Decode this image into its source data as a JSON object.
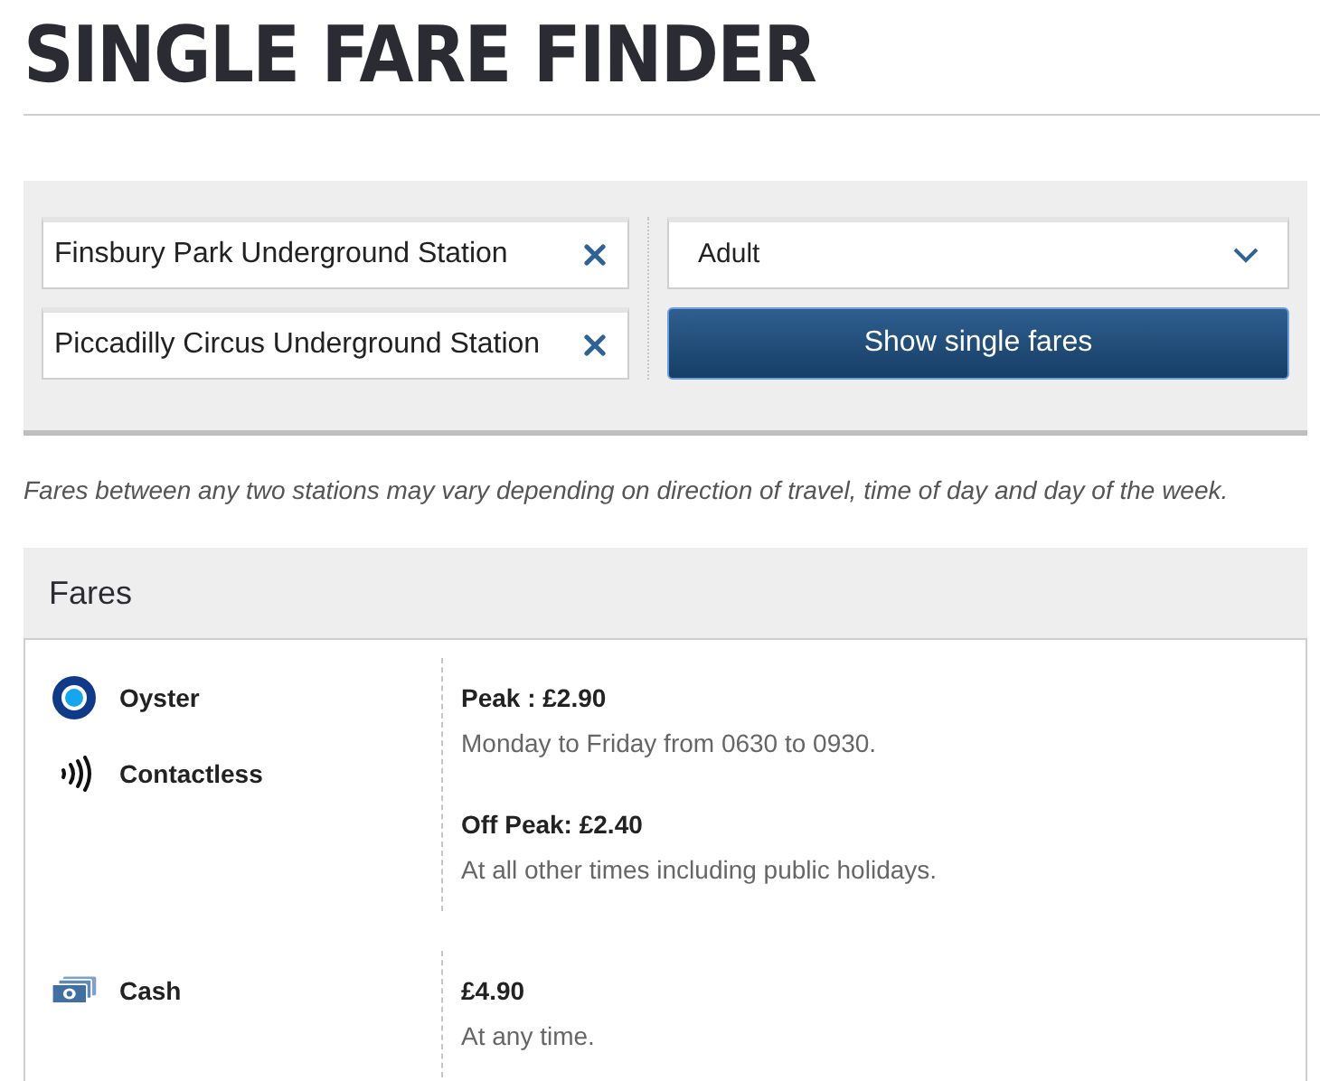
{
  "title": "SINGLE FARE FINDER",
  "search": {
    "from": {
      "value": "Finsbury Park Underground Station"
    },
    "to": {
      "value": "Piccadilly Circus Underground Station"
    },
    "passenger": {
      "value": "Adult"
    },
    "submit": "Show single fares"
  },
  "note": "Fares between any two stations may vary depending on direction of travel, time of day and day of the week.",
  "fares": {
    "heading": "Fares",
    "groups": [
      {
        "methods": [
          {
            "kind": "oyster",
            "label": "Oyster"
          },
          {
            "kind": "contactless",
            "label": "Contactless"
          }
        ],
        "prices": [
          {
            "title": "Peak : £2.90",
            "detail": "Monday to Friday from 0630 to 0930."
          },
          {
            "title": "Off Peak: £2.40",
            "detail": "At all other times including public holidays."
          }
        ]
      },
      {
        "methods": [
          {
            "kind": "cash",
            "label": "Cash"
          }
        ],
        "prices": [
          {
            "title": "£4.90",
            "detail": "At any time."
          }
        ]
      }
    ]
  }
}
